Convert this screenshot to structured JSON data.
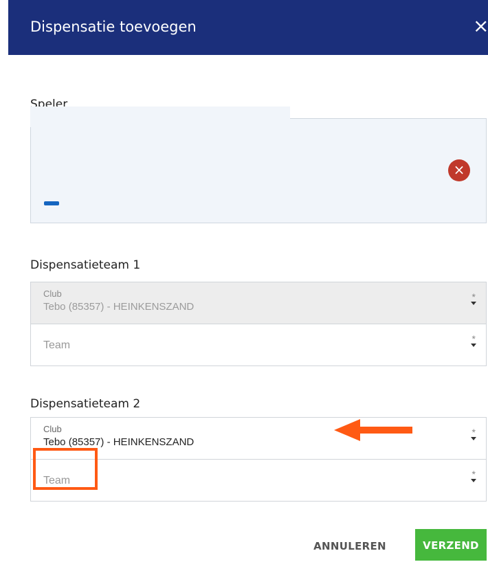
{
  "dialog": {
    "title": "Dispensatie toevoegen",
    "close_icon": "×"
  },
  "player": {
    "label": "Speler",
    "remove_icon": "×"
  },
  "team1": {
    "heading": "Dispensatieteam 1",
    "club_label": "Club",
    "club_value": "Tebo (85357) - HEINKENSZAND",
    "club_required": "*",
    "team_placeholder": "Team",
    "team_required": "*"
  },
  "team2": {
    "heading": "Dispensatieteam 2",
    "club_label": "Club",
    "club_value": "Tebo (85357) - HEINKENSZAND",
    "club_required": "*",
    "team_placeholder": "Team",
    "team_required": "*"
  },
  "actions": {
    "cancel": "ANNULEREN",
    "submit": "VERZEND"
  },
  "colors": {
    "header": "#1b2f7b",
    "submit": "#46b83d",
    "remove": "#c0392b",
    "annotation": "#ff5a14"
  },
  "icons": {
    "close": "close-icon",
    "remove": "remove-circle-icon",
    "dropdown": "caret-down-icon"
  }
}
